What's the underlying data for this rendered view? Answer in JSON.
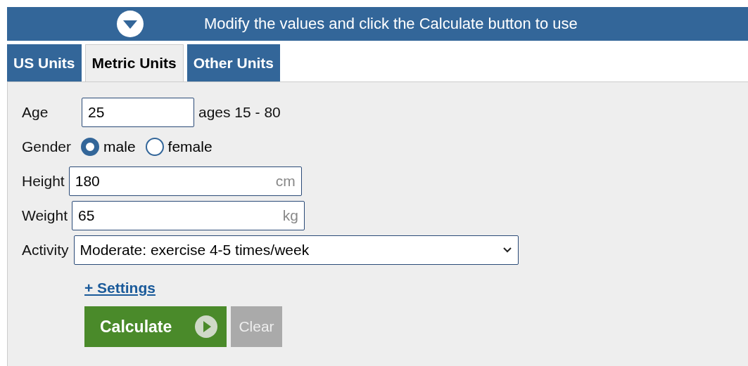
{
  "banner": {
    "text": "Modify the values and click the Calculate button to use"
  },
  "tabs": [
    {
      "label": "US Units",
      "selected": false
    },
    {
      "label": "Metric Units",
      "selected": true
    },
    {
      "label": "Other Units",
      "selected": false
    }
  ],
  "age": {
    "label": "Age",
    "value": "25",
    "hint": "ages 15 - 80"
  },
  "gender": {
    "label": "Gender",
    "options": [
      {
        "label": "male",
        "selected": true
      },
      {
        "label": "female",
        "selected": false
      }
    ]
  },
  "height": {
    "label": "Height",
    "value": "180",
    "unit": "cm"
  },
  "weight": {
    "label": "Weight",
    "value": "65",
    "unit": "kg"
  },
  "activity": {
    "label": "Activity",
    "value": "Moderate: exercise 4-5 times/week"
  },
  "settings_link": "+ Settings",
  "buttons": [
    {
      "label": "Calculate",
      "kind": "primary"
    },
    {
      "label": "Clear",
      "kind": "secondary"
    }
  ]
}
